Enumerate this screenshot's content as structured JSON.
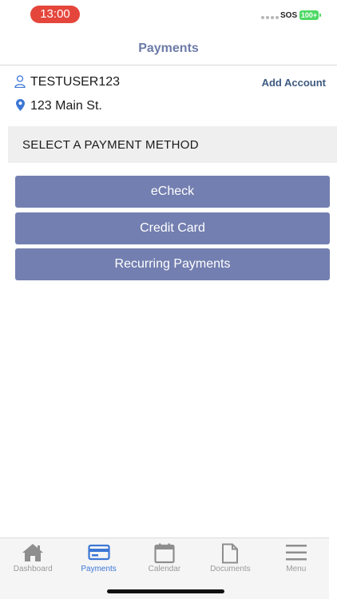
{
  "status_bar": {
    "time": "13:00",
    "carrier": "SOS",
    "battery": "100+"
  },
  "header": {
    "title": "Payments"
  },
  "account": {
    "username": "TESTUSER123",
    "address": "123 Main St.",
    "add_account_label": "Add Account"
  },
  "section": {
    "title": "SELECT A PAYMENT METHOD"
  },
  "payment_methods": [
    "eCheck",
    "Credit Card",
    "Recurring Payments"
  ],
  "tabs": [
    {
      "label": "Dashboard",
      "icon": "home-icon",
      "active": false
    },
    {
      "label": "Payments",
      "icon": "credit-card-icon",
      "active": true
    },
    {
      "label": "Calendar",
      "icon": "calendar-icon",
      "active": false
    },
    {
      "label": "Documents",
      "icon": "document-icon",
      "active": false
    },
    {
      "label": "Menu",
      "icon": "menu-icon",
      "active": false
    }
  ],
  "colors": {
    "accent": "#737fb0",
    "header_title": "#6c7ba8",
    "link": "#3d5a80",
    "tab_active": "#3c77d6",
    "time_pill": "#e5463c"
  }
}
